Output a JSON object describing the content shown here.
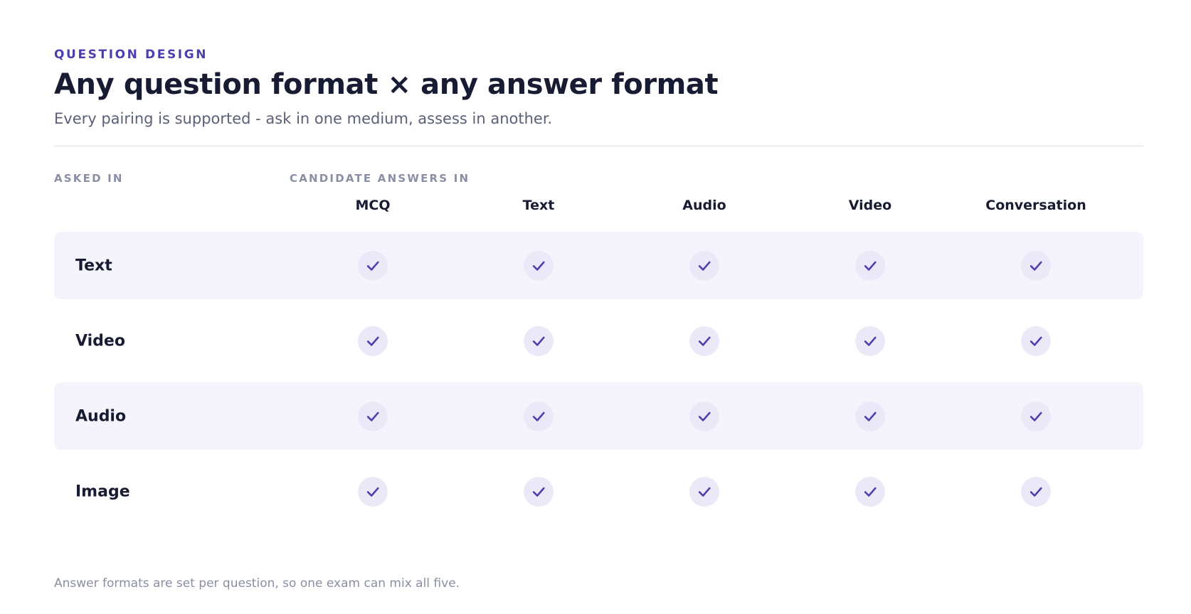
{
  "header": {
    "eyebrow": "QUESTION DESIGN",
    "title": "Any question format × any answer format",
    "subtitle": "Every pairing is supported - ask in one medium, assess in another."
  },
  "matrix": {
    "row_axis_label": "ASKED IN",
    "column_axis_label": "CANDIDATE ANSWERS IN",
    "columns": [
      "MCQ",
      "Text",
      "Audio",
      "Video",
      "Conversation"
    ],
    "rows": [
      {
        "label": "Text",
        "supported": [
          true,
          true,
          true,
          true,
          true
        ]
      },
      {
        "label": "Video",
        "supported": [
          true,
          true,
          true,
          true,
          true
        ]
      },
      {
        "label": "Audio",
        "supported": [
          true,
          true,
          true,
          true,
          true
        ]
      },
      {
        "label": "Image",
        "supported": [
          true,
          true,
          true,
          true,
          true
        ]
      }
    ]
  },
  "footnote": "Answer formats are set per question, so one exam can mix all five.",
  "icons": {
    "cell_icon": "check-icon"
  },
  "colors": {
    "accent": "#4b3fae",
    "check_background": "#ebe8f8",
    "row_shade": "#f5f4fc",
    "heading": "#171c33",
    "muted": "#8a8fa3"
  }
}
